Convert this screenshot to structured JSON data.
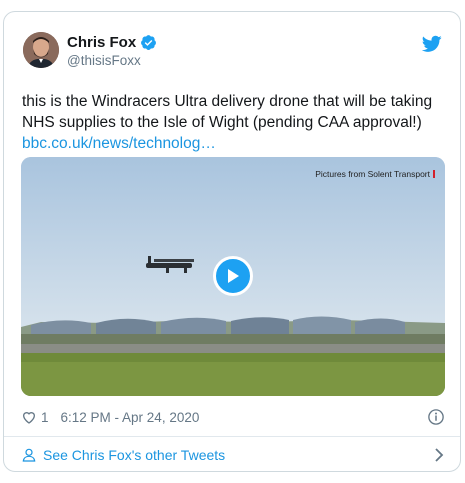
{
  "author": {
    "name": "Chris Fox",
    "handle": "@thisisFoxx"
  },
  "tweet": {
    "text": "this is the Windracers Ultra delivery drone that will be taking NHS supplies to the Isle of Wight (pending CAA approval!) ",
    "link": "bbc.co.uk/news/technolog…"
  },
  "media": {
    "credit": "Pictures from Solent Transport"
  },
  "meta": {
    "likes": "1",
    "timestamp": "6:12 PM - Apr 24, 2020"
  },
  "footer": {
    "label": "See Chris Fox's other Tweets"
  },
  "colors": {
    "accent": "#1da1f2",
    "link": "#1b95e0",
    "muted": "#657786"
  },
  "icons": [
    "verified-badge-icon",
    "twitter-bird-icon",
    "play-icon",
    "heart-icon",
    "info-icon",
    "person-icon",
    "chevron-right-icon"
  ]
}
